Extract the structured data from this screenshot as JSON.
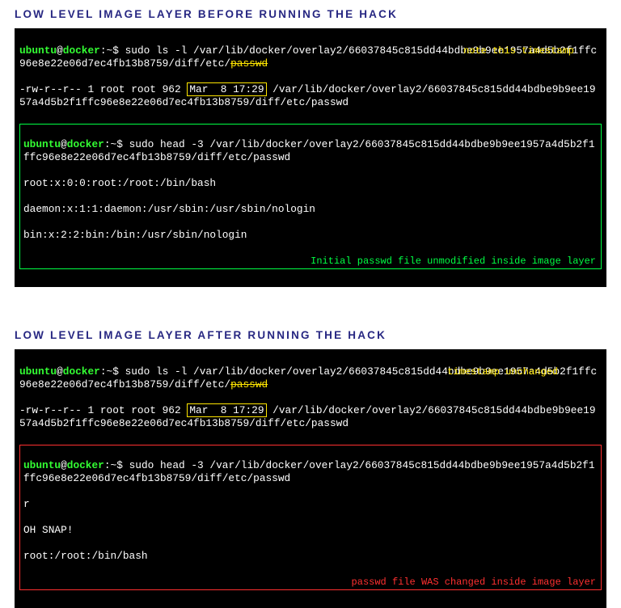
{
  "headings": {
    "before": "LOW LEVEL IMAGE LAYER BEFORE RUNNING THE HACK",
    "after": "LOW LEVEL IMAGE LAYER AFTER RUNNING THE HACK"
  },
  "prompt": {
    "user": "ubuntu",
    "at": "@",
    "host": "docker",
    "colon": ":",
    "path": "~",
    "dollar": "$"
  },
  "before": {
    "cmd1": " sudo ls -l /var/lib/docker/overlay2/66037845c815dd44bdbe9b9ee1957a4d5b2f1ffc96e8e22e06d7ec4fb13b8759/diff/etc/",
    "cmd1_tail": "passwd",
    "ann1": "note this timestamp",
    "ls_pre": "-rw-r--r-- 1 root root 962 ",
    "ls_date": "Mar  8 17:29",
    "ls_post": " /var/lib/docker/overlay2/66037845c815dd44bdbe9b9ee1957a4d5b2f1ffc96e8e22e06d7ec4fb13b8759/diff/etc/passwd",
    "cmd2": " sudo head -3 /var/lib/docker/overlay2/66037845c815dd44bdbe9b9ee1957a4d5b2f1ffc96e8e22e06d7ec4fb13b8759/diff/etc/passwd",
    "out1": "root:x:0:0:root:/root:/bin/bash",
    "out2": "daemon:x:1:1:daemon:/usr/sbin:/usr/sbin/nologin",
    "out3": "bin:x:2:2:bin:/bin:/usr/sbin/nologin",
    "ann2": "Initial passwd file unmodified inside image layer"
  },
  "after": {
    "cmd1": " sudo ls -l /var/lib/docker/overlay2/66037845c815dd44bdbe9b9ee1957a4d5b2f1ffc96e8e22e06d7ec4fb13b8759/diff/etc/",
    "cmd1_tail": "passwd",
    "ann1": "timestamp unchanged",
    "ls_pre": "-rw-r--r-- 1 root root 962 ",
    "ls_date": "Mar  8 17:29",
    "ls_post": " /var/lib/docker/overlay2/66037845c815dd44bdbe9b9ee1957a4d5b2f1ffc96e8e22e06d7ec4fb13b8759/diff/etc/passwd",
    "cmd2": " sudo head -3 /var/lib/docker/overlay2/66037845c815dd44bdbe9b9ee1957a4d5b2f1ffc96e8e22e06d7ec4fb13b8759/diff/etc/passwd",
    "out1": "r",
    "out2": "OH SNAP!",
    "out3": "root:/root:/bin/bash",
    "ann2": "passwd file WAS changed inside image layer"
  }
}
